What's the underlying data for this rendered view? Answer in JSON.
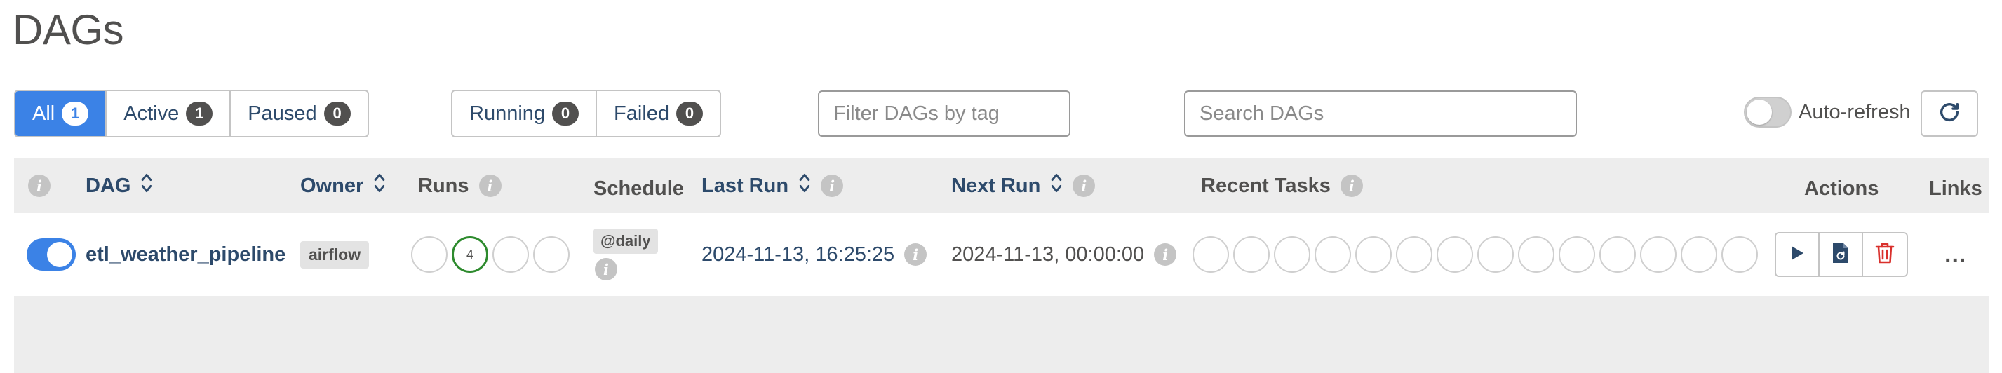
{
  "page": {
    "title": "DAGs"
  },
  "status_filters": [
    {
      "label": "All",
      "count": "1"
    },
    {
      "label": "Active",
      "count": "1"
    },
    {
      "label": "Paused",
      "count": "0"
    }
  ],
  "run_filters": [
    {
      "label": "Running",
      "count": "0"
    },
    {
      "label": "Failed",
      "count": "0"
    }
  ],
  "tag_filter": {
    "placeholder": "Filter DAGs by tag"
  },
  "search": {
    "placeholder": "Search DAGs"
  },
  "auto_refresh": {
    "label": "Auto-refresh",
    "enabled": false
  },
  "table": {
    "headers": {
      "dag": "DAG",
      "owner": "Owner",
      "runs": "Runs",
      "schedule": "Schedule",
      "last_run": "Last Run",
      "next_run": "Next Run",
      "recent_tasks": "Recent Tasks",
      "actions": "Actions",
      "links": "Links"
    },
    "rows": [
      {
        "active": true,
        "dag_id": "etl_weather_pipeline",
        "owner": "airflow",
        "runs": [
          "",
          "4",
          "",
          ""
        ],
        "schedule": "@daily",
        "last_run": "2024-11-13, 16:25:25",
        "next_run": "2024-11-13, 00:00:00",
        "recent_task_count": 14,
        "links_label": "..."
      }
    ]
  },
  "colors": {
    "primary": "#3b82e6",
    "link": "#2d4a6b",
    "success": "#2e8b2e",
    "danger": "#d9302c",
    "badge": "#51504f"
  },
  "icons": {
    "info": "info-icon",
    "sort": "sort-icon",
    "refresh": "refresh-icon",
    "trigger": "play-icon",
    "reparse": "reparse-file-icon",
    "delete": "trash-icon",
    "links": "more-dots-icon"
  }
}
